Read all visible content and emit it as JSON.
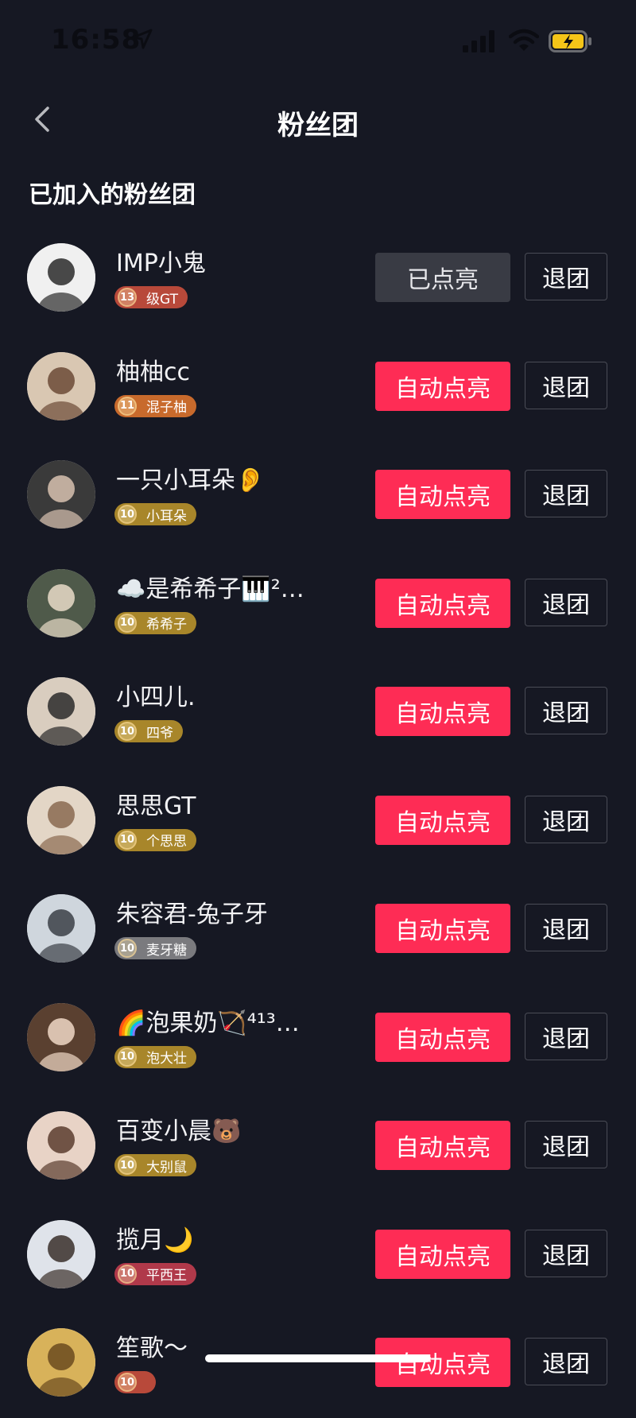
{
  "status_bar": {
    "time": "16:58"
  },
  "header": {
    "title": "粉丝团"
  },
  "section": {
    "title": "已加入的粉丝团"
  },
  "colors": {
    "accent": "#fe2c55",
    "background": "#161823",
    "lit_button": "#393b44"
  },
  "fan_clubs": [
    {
      "name": "IMP小鬼",
      "level": "13",
      "badge": "级GT",
      "badge_color": "#b8493a",
      "action": "已点亮",
      "action_type": "lit",
      "quit": "退团",
      "avatar_bg": "#f0f0f0",
      "avatar_fg": "#2a2a2a"
    },
    {
      "name": "柚柚cc",
      "level": "11",
      "badge": "混子柚",
      "badge_color": "#c86a2c",
      "action": "自动点亮",
      "action_type": "auto",
      "quit": "退团",
      "avatar_bg": "#d9c7b2",
      "avatar_fg": "#6b4a36"
    },
    {
      "name": "一只小耳朵👂",
      "level": "10",
      "badge": "小耳朵",
      "badge_color": "#a8862a",
      "action": "自动点亮",
      "action_type": "auto",
      "quit": "退团",
      "avatar_bg": "#3a3a3a",
      "avatar_fg": "#d8c2b0"
    },
    {
      "name": "☁️是希希子🎹²…",
      "level": "10",
      "badge": "希希子",
      "badge_color": "#a8862a",
      "action": "自动点亮",
      "action_type": "auto",
      "quit": "退团",
      "avatar_bg": "#4f5a4a",
      "avatar_fg": "#e9dcc8"
    },
    {
      "name": "小四儿.",
      "level": "10",
      "badge": "四爷",
      "badge_color": "#a8862a",
      "action": "自动点亮",
      "action_type": "auto",
      "quit": "退团",
      "avatar_bg": "#d9cdbf",
      "avatar_fg": "#2a2a2a"
    },
    {
      "name": "思思GT",
      "level": "10",
      "badge": "个思思",
      "badge_color": "#a8862a",
      "action": "自动点亮",
      "action_type": "auto",
      "quit": "退团",
      "avatar_bg": "#e3d6c6",
      "avatar_fg": "#8a6a50"
    },
    {
      "name": "朱容君-兔子牙",
      "level": "10",
      "badge": "麦牙糖",
      "badge_color": "#7a7a7e",
      "action": "自动点亮",
      "action_type": "auto",
      "quit": "退团",
      "avatar_bg": "#cfd6dd",
      "avatar_fg": "#3b3f46"
    },
    {
      "name": "🌈泡果奶🏹⁴¹³…",
      "level": "10",
      "badge": "泡大壮",
      "badge_color": "#a8862a",
      "action": "自动点亮",
      "action_type": "auto",
      "quit": "退团",
      "avatar_bg": "#5a4030",
      "avatar_fg": "#f0d8c6"
    },
    {
      "name": "百变小晨🐻",
      "level": "10",
      "badge": "大别鼠",
      "badge_color": "#a8862a",
      "action": "自动点亮",
      "action_type": "auto",
      "quit": "退团",
      "avatar_bg": "#e8d3c6",
      "avatar_fg": "#5a3c2e"
    },
    {
      "name": "揽月🌙",
      "level": "10",
      "badge": "平西王",
      "badge_color": "#b0394a",
      "action": "自动点亮",
      "action_type": "auto",
      "quit": "退团",
      "avatar_bg": "#dfe3ea",
      "avatar_fg": "#3a2f2a"
    },
    {
      "name": "笙歌～",
      "level": "10",
      "badge": "",
      "badge_color": "#b8493a",
      "action": "自动点亮",
      "action_type": "auto",
      "quit": "退团",
      "avatar_bg": "#d8b25a",
      "avatar_fg": "#6b4a1e"
    }
  ]
}
